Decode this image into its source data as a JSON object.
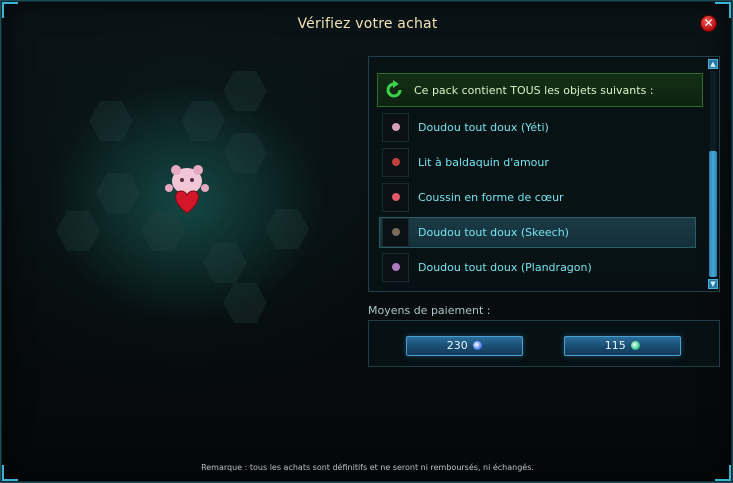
{
  "window": {
    "title": "Vérifiez votre achat",
    "close_icon": "✕"
  },
  "pack": {
    "header": "Ce pack contient TOUS les objets suivants :",
    "items": [
      {
        "label": "Doudou tout doux (Yéti)",
        "selected": false,
        "color": "#d7a0b8"
      },
      {
        "label": "Lit à baldaquin d'amour",
        "selected": false,
        "color": "#c0403c"
      },
      {
        "label": "Coussin en forme de cœur",
        "selected": false,
        "color": "#e05a6a"
      },
      {
        "label": "Doudou tout doux (Skeech)",
        "selected": true,
        "color": "#7a6a5a"
      },
      {
        "label": "Doudou tout doux (Plandragon)",
        "selected": false,
        "color": "#b07ac0"
      }
    ]
  },
  "payment": {
    "label": "Moyens de paiement :",
    "options": [
      {
        "amount": "230",
        "currency_icon": "ogrine-icon",
        "color": "#4e84ff"
      },
      {
        "amount": "115",
        "currency_icon": "kama-icon",
        "color": "#4bd19a"
      }
    ]
  },
  "remark": "Remarque : tous les achats sont définitifs et ne seront ni remboursés, ni échangés."
}
